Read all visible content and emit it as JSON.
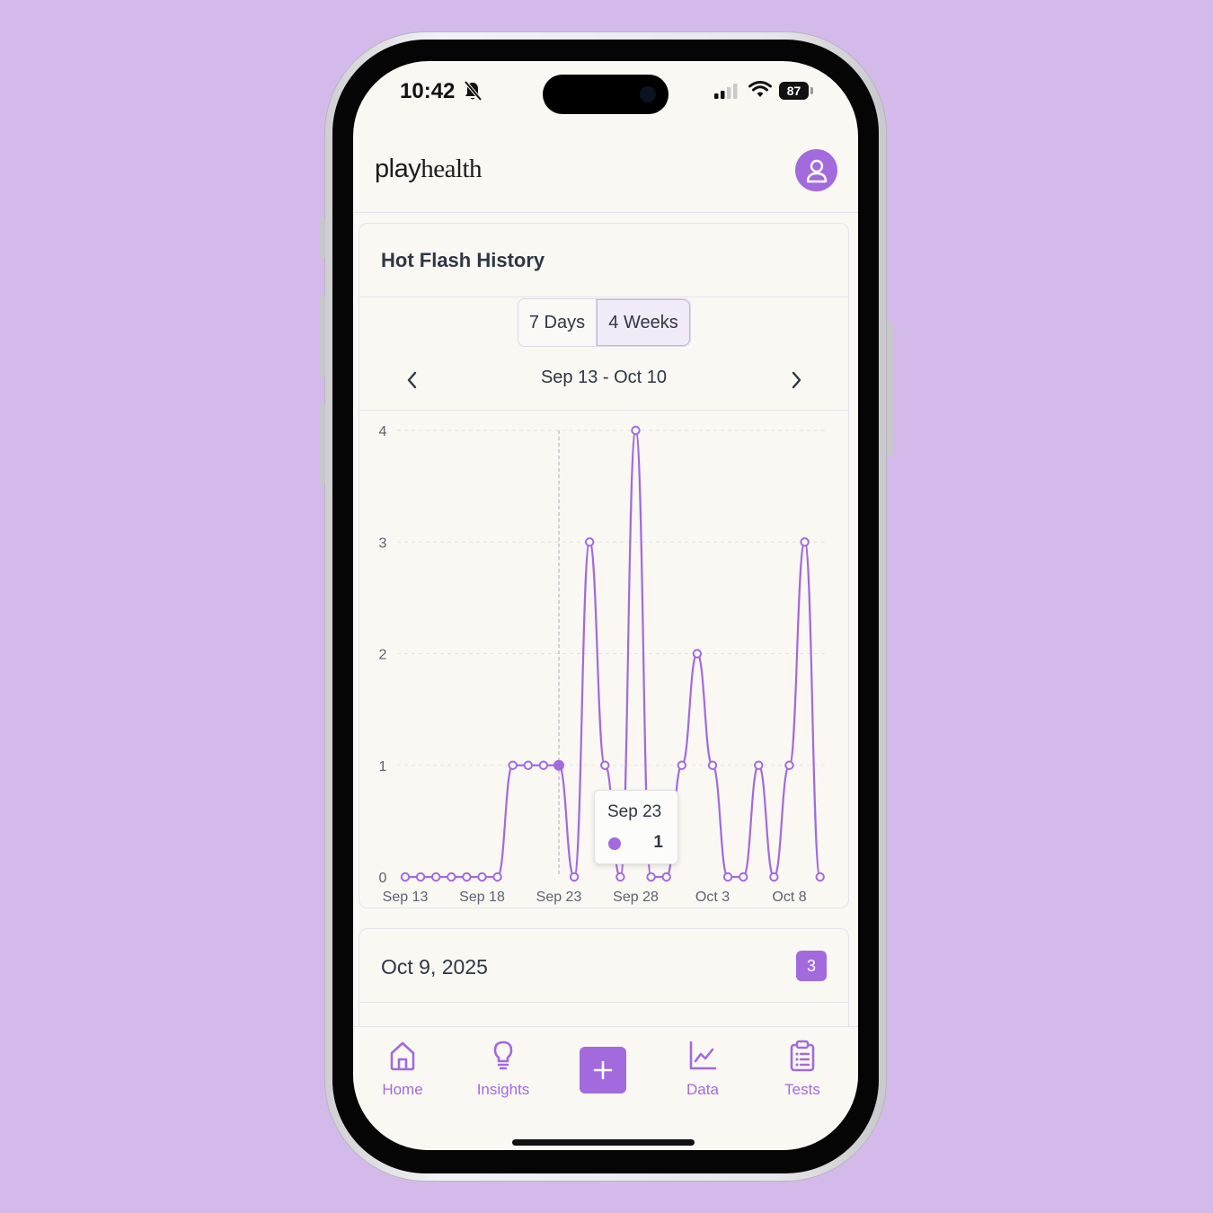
{
  "status_bar": {
    "time": "10:42",
    "battery": "87"
  },
  "header": {
    "brand_play": "play",
    "brand_health": "health"
  },
  "history_card": {
    "title": "Hot Flash History",
    "range_options": [
      "7 Days",
      "4 Weeks"
    ],
    "selected_range": "4 Weeks",
    "date_range": "Sep 13 - Oct 10"
  },
  "chart_data": {
    "type": "line",
    "x": [
      "Sep 13",
      "Sep 14",
      "Sep 15",
      "Sep 16",
      "Sep 17",
      "Sep 18",
      "Sep 19",
      "Sep 20",
      "Sep 21",
      "Sep 22",
      "Sep 23",
      "Sep 24",
      "Sep 25",
      "Sep 26",
      "Sep 27",
      "Sep 28",
      "Sep 29",
      "Sep 30",
      "Oct 1",
      "Oct 2",
      "Oct 3",
      "Oct 4",
      "Oct 5",
      "Oct 6",
      "Oct 7",
      "Oct 8",
      "Oct 9",
      "Oct 10"
    ],
    "values": [
      0,
      0,
      0,
      0,
      0,
      0,
      0,
      1,
      1,
      1,
      1,
      0,
      3,
      1,
      0,
      4,
      0,
      0,
      1,
      2,
      1,
      0,
      0,
      1,
      0,
      1,
      3,
      0
    ],
    "x_tick_labels": [
      "Sep 13",
      "Sep 18",
      "Sep 23",
      "Sep 28",
      "Oct 3",
      "Oct 8"
    ],
    "y_tick_labels": [
      "0",
      "1",
      "2",
      "3",
      "4"
    ],
    "ylim": [
      0,
      4
    ],
    "grid": true,
    "series_color": "#a36ade",
    "tooltip": {
      "date": "Sep 23",
      "value": "1"
    }
  },
  "day_card": {
    "title": "Oct 9, 2025",
    "count": "3"
  },
  "tabbar": {
    "tabs": [
      {
        "label": "Home",
        "icon": "home-icon"
      },
      {
        "label": "Insights",
        "icon": "lightbulb-icon"
      },
      {
        "label": "Data",
        "icon": "chart-icon"
      },
      {
        "label": "Tests",
        "icon": "clipboard-icon"
      }
    ],
    "add_icon": "plus-icon"
  },
  "colors": {
    "background": "#d4baea",
    "accent": "#a36ade",
    "screen": "#f9f8f3",
    "text": "#2f3645"
  }
}
